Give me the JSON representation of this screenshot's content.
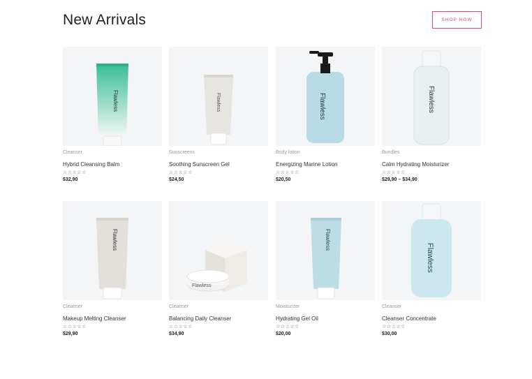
{
  "header": {
    "title": "New Arrivals",
    "shop_label": "SHOP NOW"
  },
  "brand": "Flawless",
  "rating_display": "☆☆☆☆☆",
  "colors": {
    "accent": "#e0457b",
    "thumb_bg": "#f4f5f7"
  },
  "products": [
    {
      "category": "Cleanser",
      "name": "Hybrid Cleansing Balm",
      "price": "$32,90",
      "rating": 0
    },
    {
      "category": "Sunscreens",
      "name": "Soothing Sunscreen Gel",
      "price": "$24,50",
      "rating": 0
    },
    {
      "category": "Body lotion",
      "name": "Energizing Marine Lotion",
      "price": "$20,50",
      "rating": 0
    },
    {
      "category": "Bundles",
      "name": "Calm Hydrating Moisturizer",
      "price": "$29,90 – $34,90",
      "rating": 0
    },
    {
      "category": "Cleanser",
      "name": "Makeup Melting Cleanser",
      "price": "$29,90",
      "rating": 0
    },
    {
      "category": "Cleanser",
      "name": "Balancing Daily Cleanser",
      "price": "$34,90",
      "rating": 0
    },
    {
      "category": "Moisturizer",
      "name": "Hydrating Gel Oil",
      "price": "$20,00",
      "rating": 0
    },
    {
      "category": "Cleanser",
      "name": "Cleanser Concentrate",
      "price": "$30,00",
      "rating": 0
    }
  ]
}
